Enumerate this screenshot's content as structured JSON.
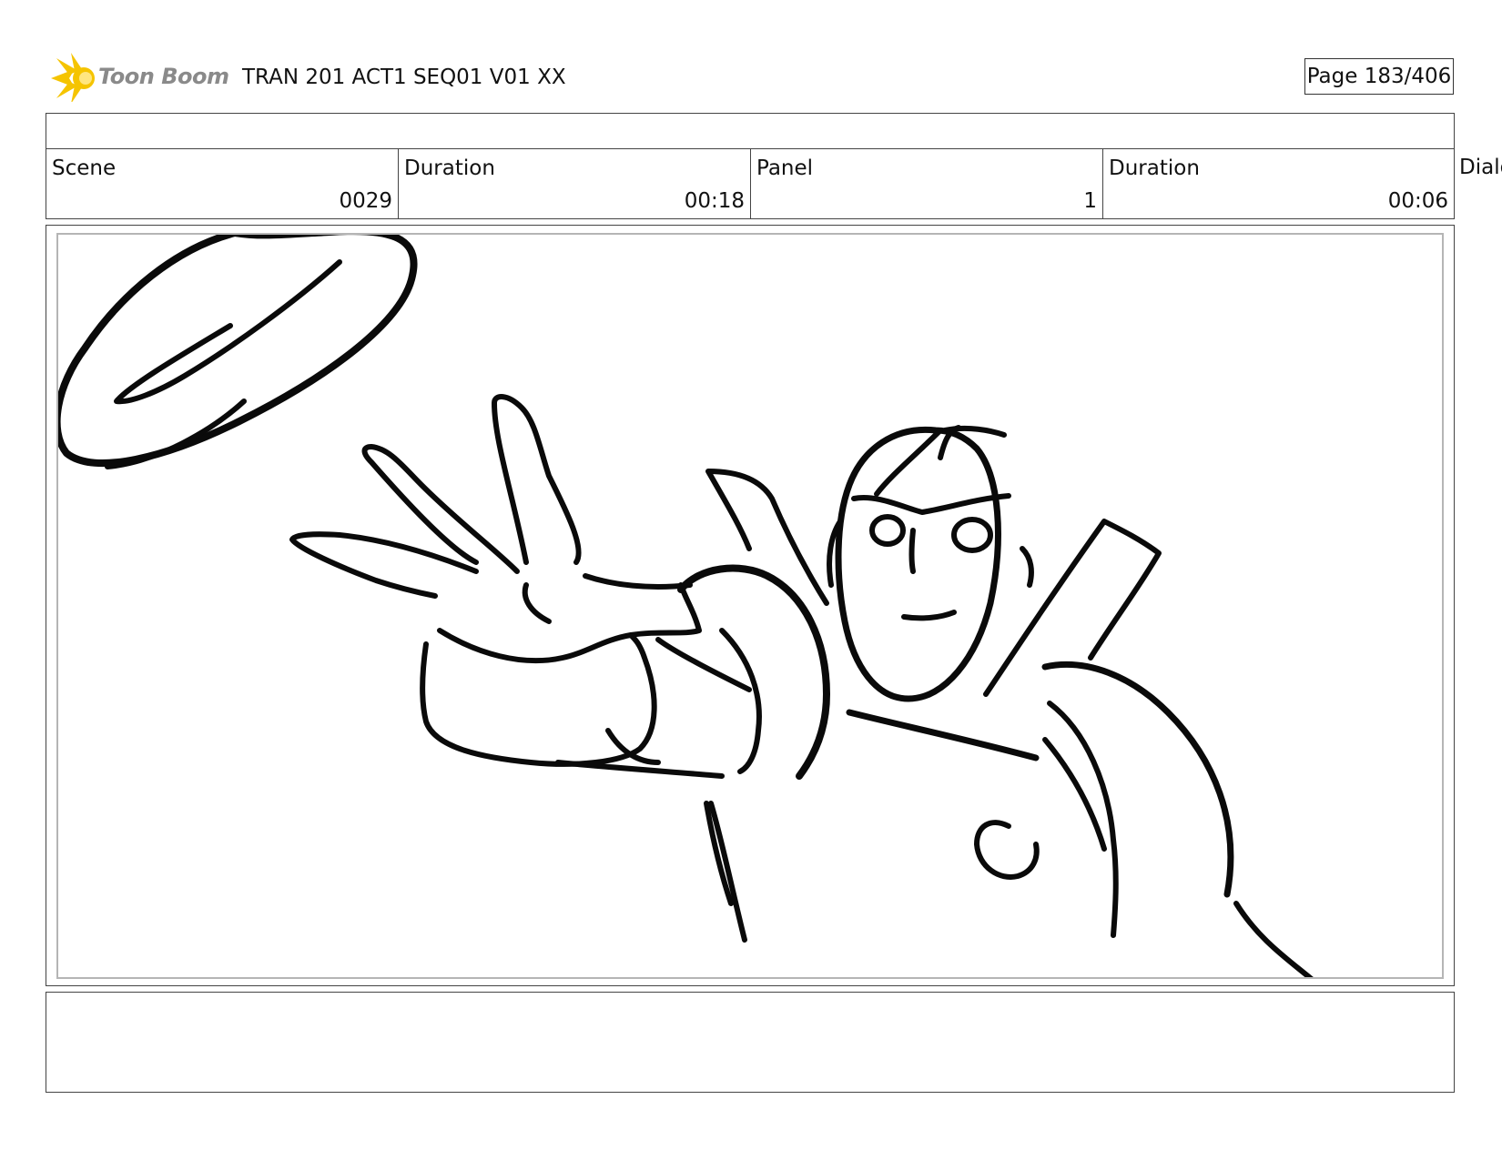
{
  "header": {
    "logo_icon": "toon-boom-star-logo",
    "logo_text": "Toon Boom",
    "logo_color": "#f5c400",
    "title": "TRAN 201 ACT1 SEQ01 V01 XX",
    "page": "Page 183/406"
  },
  "info": {
    "scene_label": "Scene",
    "scene_value": "0029",
    "scene_duration_label": "Duration",
    "scene_duration_value": "00:18",
    "panel_label": "Panel",
    "panel_value": "1",
    "panel_duration_label": "Duration",
    "panel_duration_value": "00:06",
    "dialog_label": "Dialog"
  },
  "panel": {
    "sketch": "storyboard-sketch-character-reaching-for-flying-disc"
  },
  "notes": {
    "text": ""
  }
}
